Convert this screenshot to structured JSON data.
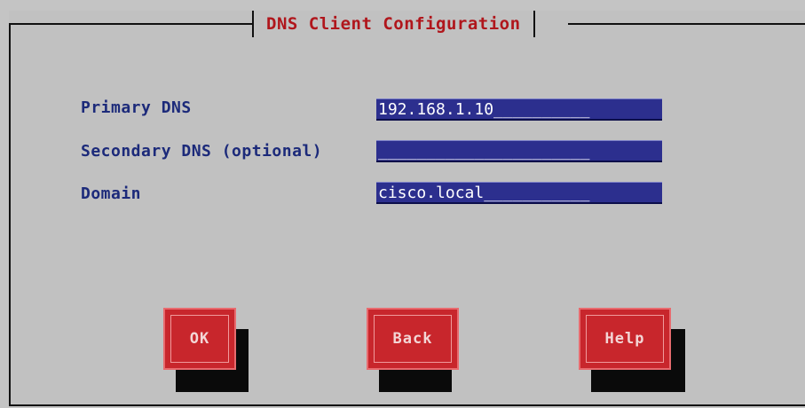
{
  "dialog": {
    "title": "DNS Client Configuration"
  },
  "fields": [
    {
      "label": "Primary DNS",
      "value": "192.168.1.10",
      "fill": "__________"
    },
    {
      "label": "Secondary DNS (optional)",
      "value": "",
      "fill": "______________________"
    },
    {
      "label": "Domain",
      "value": "cisco.local",
      "fill": "___________"
    }
  ],
  "buttons": {
    "ok": "OK",
    "back": "Back",
    "help": "Help"
  },
  "colors": {
    "background": "#c1c1c1",
    "title": "#b0161c",
    "label": "#1c2a7a",
    "field": "#2c2f8e",
    "button": "#c8262c"
  }
}
